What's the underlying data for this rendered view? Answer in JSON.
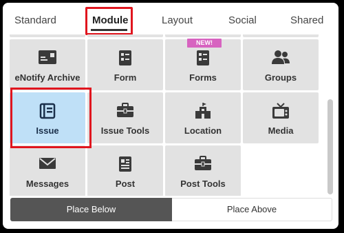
{
  "tabs": [
    {
      "label": "Standard"
    },
    {
      "label": "Module"
    },
    {
      "label": "Layout"
    },
    {
      "label": "Social"
    },
    {
      "label": "Shared"
    }
  ],
  "active_tab": "Module",
  "badge": "NEW!",
  "tiles": [
    {
      "label": "eNotify Archive",
      "icon": "archive-card-icon"
    },
    {
      "label": "Form",
      "icon": "form-icon"
    },
    {
      "label": "Forms",
      "icon": "forms-icon"
    },
    {
      "label": "Groups",
      "icon": "groups-icon"
    },
    {
      "label": "Issue",
      "icon": "issue-icon"
    },
    {
      "label": "Issue Tools",
      "icon": "toolbox-icon"
    },
    {
      "label": "Location",
      "icon": "location-building-icon"
    },
    {
      "label": "Media",
      "icon": "tv-icon"
    },
    {
      "label": "Messages",
      "icon": "envelope-icon"
    },
    {
      "label": "Post",
      "icon": "newspaper-icon"
    },
    {
      "label": "Post Tools",
      "icon": "toolbox-icon"
    }
  ],
  "selected_tile": "Issue",
  "buttons": {
    "place_below": "Place Below",
    "place_above": "Place Above"
  },
  "colors": {
    "accent_red": "#e0151e",
    "selected_tile": "#bfe0f7",
    "badge": "#d763c0",
    "active_button": "#555555"
  }
}
